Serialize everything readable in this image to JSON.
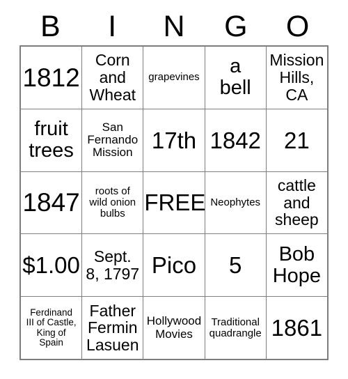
{
  "card": {
    "type": "bingo-card",
    "header": {
      "letters": [
        "B",
        "I",
        "N",
        "G",
        "O"
      ]
    },
    "grid": {
      "columns": 5,
      "rows": 5,
      "border_color": "#7d7d7d",
      "background_color": "#ffffff",
      "text_color": "#000000",
      "free_space": {
        "row": 3,
        "column": 3,
        "label": "FREE"
      }
    },
    "cells": [
      [
        {
          "text": "1812",
          "size": "xxl"
        },
        {
          "text": "Corn\nand\nWheat",
          "size": "m"
        },
        {
          "text": "grapevines",
          "size": "xs"
        },
        {
          "text": "a\nbell",
          "size": "l"
        },
        {
          "text": "Mission\nHills,\nCA",
          "size": "m"
        }
      ],
      [
        {
          "text": "fruit\ntrees",
          "size": "l"
        },
        {
          "text": "San\nFernando\nMission",
          "size": "s"
        },
        {
          "text": "17th",
          "size": "xl"
        },
        {
          "text": "1842",
          "size": "xl"
        },
        {
          "text": "21",
          "size": "xl"
        }
      ],
      [
        {
          "text": "1847",
          "size": "xxl"
        },
        {
          "text": "roots of\nwild onion\nbulbs",
          "size": "xs"
        },
        {
          "text": "FREE",
          "size": "xl"
        },
        {
          "text": "Neophytes",
          "size": "xs"
        },
        {
          "text": "cattle\nand\nsheep",
          "size": "m"
        }
      ],
      [
        {
          "text": "$1.00",
          "size": "xl"
        },
        {
          "text": "Sept.\n8, 1797",
          "size": "m"
        },
        {
          "text": "Pico",
          "size": "xl"
        },
        {
          "text": "5",
          "size": "xl"
        },
        {
          "text": "Bob\nHope",
          "size": "l"
        }
      ],
      [
        {
          "text": "Ferdinand\nIII of Castle,\nKing of\nSpain",
          "size": "xxs"
        },
        {
          "text": "Father\nFermin\nLasuen",
          "size": "m"
        },
        {
          "text": "Hollywood\nMovies",
          "size": "s"
        },
        {
          "text": "Traditional\nquadrangle",
          "size": "xs"
        },
        {
          "text": "1861",
          "size": "xl"
        }
      ]
    ]
  }
}
